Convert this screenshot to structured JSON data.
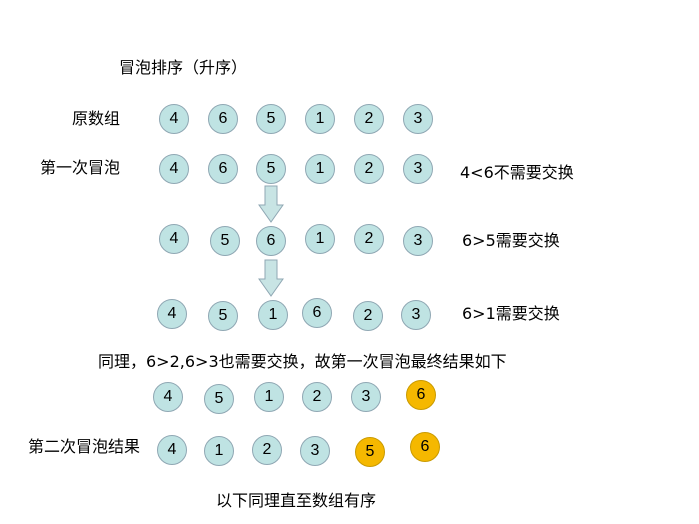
{
  "title": "冒泡排序（升序）",
  "colors": {
    "circle_fill": "#bfe3e3",
    "highlight_fill": "#f5b800",
    "arrow_fill": "#c8e4e4"
  },
  "labels": {
    "original": "原数组",
    "first_pass": "第一次冒泡",
    "second_pass_result": "第二次冒泡结果"
  },
  "rows": {
    "original": [
      "4",
      "6",
      "5",
      "1",
      "2",
      "3"
    ],
    "first_pass": [
      "4",
      "6",
      "5",
      "1",
      "2",
      "3"
    ],
    "step2": [
      "4",
      "5",
      "6",
      "1",
      "2",
      "3"
    ],
    "step3": [
      "4",
      "5",
      "1",
      "6",
      "2",
      "3"
    ],
    "pass1_result": [
      "4",
      "5",
      "1",
      "2",
      "3",
      "6"
    ],
    "pass2_result": [
      "4",
      "1",
      "2",
      "3",
      "5",
      "6"
    ]
  },
  "notes": {
    "compare1": "4<6不需要交换",
    "compare2": "6>5需要交换",
    "compare3": "6>1需要交换",
    "summary": "同理，6>2,6>3也需要交换，故第一次冒泡最终结果如下",
    "footer": "以下同理直至数组有序"
  }
}
